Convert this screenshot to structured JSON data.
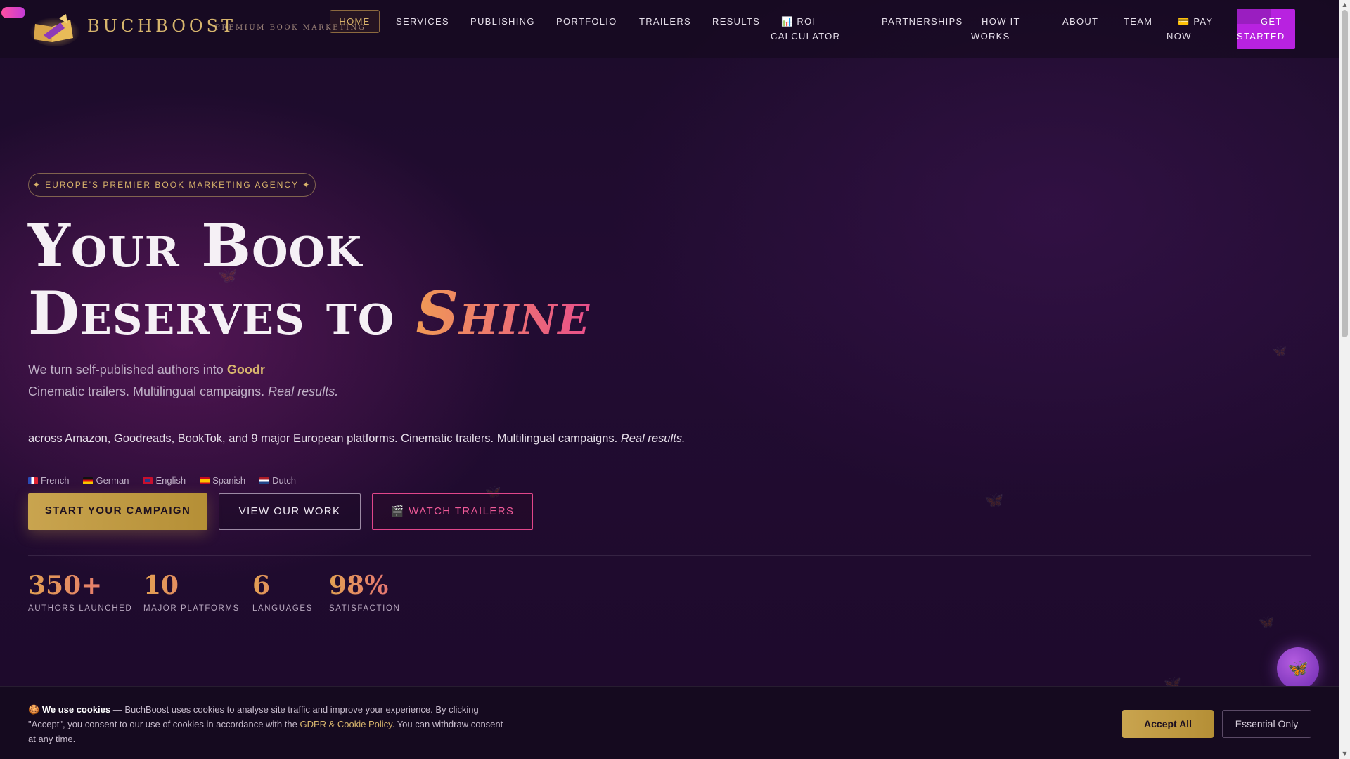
{
  "header": {
    "brand_name": "BUCHBOOST",
    "brand_tagline": "PREMIUM BOOK MARKETING",
    "nav": [
      {
        "id": "home",
        "label": "HOME"
      },
      {
        "id": "services",
        "label": "SERVICES"
      },
      {
        "id": "publishing",
        "label": "PUBLISHING"
      },
      {
        "id": "portfolio",
        "label": "PORTFOLIO"
      },
      {
        "id": "trailers",
        "label": "TRAILERS"
      },
      {
        "id": "results",
        "label": "RESULTS"
      },
      {
        "id": "roi",
        "label_line1": "📊 ROI",
        "label_line2": "CALCULATOR"
      },
      {
        "id": "partnerships",
        "label": "PARTNERSHIPS"
      },
      {
        "id": "how",
        "label_line1": "HOW IT",
        "label_line2": "WORKS"
      },
      {
        "id": "about",
        "label": "ABOUT"
      },
      {
        "id": "team",
        "label": "TEAM"
      },
      {
        "id": "pay",
        "label_line1": "💳 PAY",
        "label_line2": "NOW"
      },
      {
        "id": "get_started",
        "label_line1": "GET",
        "label_line2": "STARTED"
      }
    ]
  },
  "hero": {
    "badge": "✦ EUROPE'S PREMIER BOOK MARKETING AGENCY ✦",
    "title_line1": "Your Book",
    "title_line2_prefix": "Deserves to",
    "title_highlight": "Shine",
    "sub1_prefix": "We turn self-published authors into",
    "sub1_highlight": "Goodr",
    "sub2_main": "Cinematic trailers. Multilingual campaigns.",
    "sub2_em": "Real results.",
    "body_main": "across Amazon, Goodreads, BookTok, and 9 major European platforms. Cinematic trailers. Multilingual campaigns.",
    "body_em": "Real results.",
    "languages": [
      "French",
      "German",
      "English",
      "Spanish",
      "Dutch"
    ],
    "buttons": {
      "start": "START YOUR CAMPAIGN",
      "work": "VIEW OUR WORK",
      "trailers": "🎬 WATCH TRAILERS"
    }
  },
  "stats": [
    {
      "value": "350+",
      "label": "AUTHORS LAUNCHED"
    },
    {
      "value": "10",
      "label": "MAJOR PLATFORMS"
    },
    {
      "value": "6",
      "label": "LANGUAGES"
    },
    {
      "value": "98%",
      "label": "SATISFACTION"
    }
  ],
  "cookie": {
    "icon": "🍪",
    "title": "We use cookies",
    "text_before": " — BuchBoost uses cookies to analyse site traffic and improve your experience. By clicking \"Accept\", you consent to our use of cookies in accordance with the ",
    "link": "GDPR & Cookie Policy",
    "text_after": ". You can withdraw consent at any time.",
    "accept": "Accept All",
    "essential": "Essential Only"
  },
  "colors": {
    "gold": "#d7b56d",
    "pink": "#e94f8b",
    "purple_cta": "#b822e0",
    "background": "#1d0a2b"
  }
}
